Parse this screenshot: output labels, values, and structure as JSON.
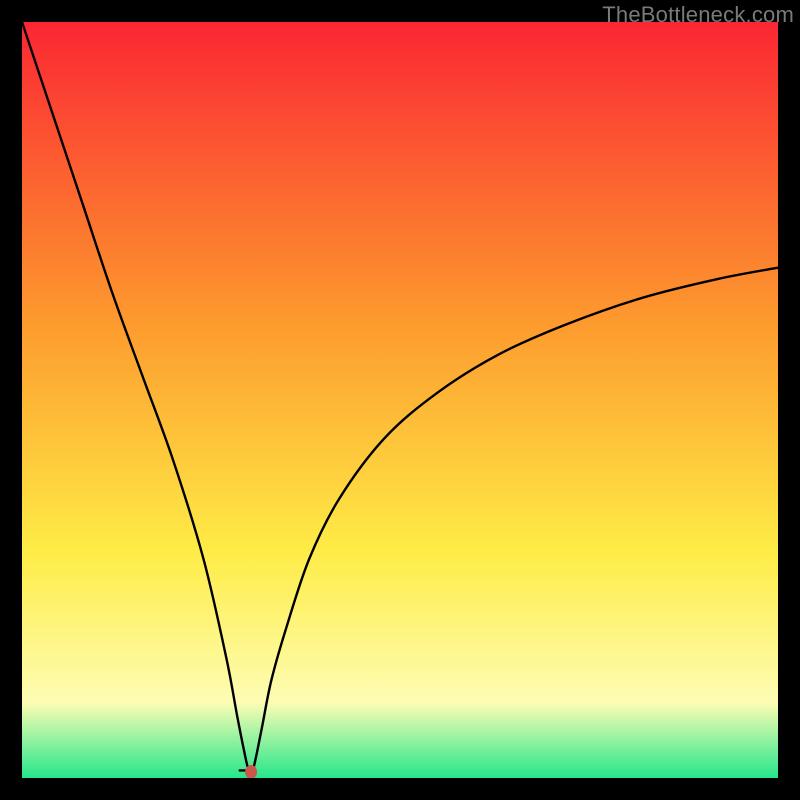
{
  "watermark": "TheBottleneck.com",
  "chart_data": {
    "type": "line",
    "title": "",
    "xlabel": "",
    "ylabel": "",
    "xlim": [
      0,
      100
    ],
    "ylim": [
      0,
      100
    ],
    "legend": false,
    "grid": false,
    "background_gradient": {
      "top": "#fb2633",
      "mid1": "#fd9b2e",
      "mid2": "#feec46",
      "mid3": "#fdfdb4",
      "bottom": "#26e68b"
    },
    "x": [
      0,
      2,
      5,
      8,
      12,
      16,
      20,
      24,
      27,
      28.5,
      29.5,
      30,
      30.5,
      31,
      31.8,
      33,
      35,
      38,
      42,
      48,
      55,
      63,
      72,
      82,
      92,
      100
    ],
    "series": [
      {
        "name": "bottleneck-curve",
        "values": [
          100,
          94,
          85,
          76,
          64,
          53,
          42,
          29,
          16,
          8,
          3,
          1,
          1,
          3,
          7,
          13,
          20,
          29,
          37,
          45,
          51,
          56,
          60,
          63.5,
          66,
          67.5
        ]
      }
    ],
    "marker": {
      "x": 30.3,
      "y": 0.8,
      "color": "#cb564c",
      "rx": 6,
      "ry": 7
    },
    "flat_segment": {
      "x0": 28.8,
      "x1": 30.1,
      "y": 1.0
    }
  }
}
